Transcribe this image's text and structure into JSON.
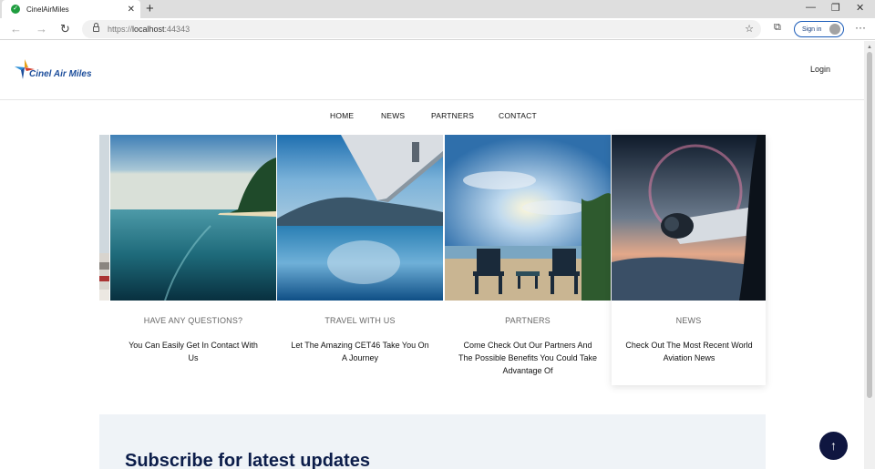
{
  "browser": {
    "tab_title": "CinelAirMiles",
    "url_scheme": "https://",
    "url_host": "localhost",
    "url_port": ":44343",
    "signin_label": "Sign in",
    "icons": [
      "site-favicon-icon",
      "tab-close-icon",
      "new-tab-icon",
      "back-icon",
      "forward-icon",
      "reload-icon",
      "lock-icon",
      "favorites-icon",
      "collections-icon",
      "profile-icon",
      "more-icon",
      "minimize-icon",
      "restore-icon",
      "window-close-icon"
    ]
  },
  "header": {
    "logo_text": "Cinel Air Miles",
    "login_label": "Login"
  },
  "nav": {
    "items": [
      "HOME",
      "NEWS",
      "PARTNERS",
      "CONTACT"
    ]
  },
  "cards": [
    {
      "category": "HAVE ANY QUESTIONS?",
      "text": "You Can Easily Get In Contact With Us"
    },
    {
      "category": "TRAVEL WITH US",
      "text": "Let The Amazing CET46 Take You On A Journey"
    },
    {
      "category": "PARTNERS",
      "text": "Come Check Out Our Partners And The Possible Benefits You Could Take Advantage Of"
    },
    {
      "category": "NEWS",
      "text": "Check Out The Most Recent World Aviation News"
    }
  ],
  "subscribe": {
    "title": "Subscribe for latest updates"
  },
  "colors": {
    "brand_navy": "#0c1d4a",
    "logo_blue": "#1e4f9c",
    "subscribe_bg": "#eff3f7",
    "back_to_top": "#0f1640"
  }
}
